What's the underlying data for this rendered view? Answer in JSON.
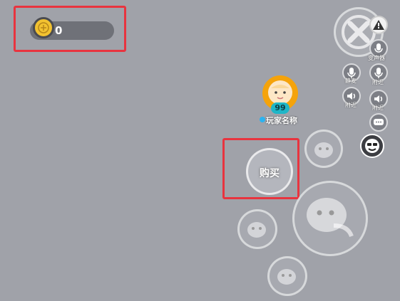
{
  "hud": {
    "coin_count": "0"
  },
  "player": {
    "level": "99",
    "name": "玩家名称"
  },
  "buy_button": {
    "label": "购买"
  },
  "voice": {
    "voice_changer_label": "变声器",
    "mic_mute_label": "静麦",
    "mic_nearby_label": "附近",
    "speaker_nearby_label": "附近",
    "speaker_nearby2_label": "附近"
  },
  "colors": {
    "background": "#a0a2a9",
    "highlight_box": "#e8343f",
    "coin": "#f2c230",
    "level_badge": "#1fb6c7"
  },
  "icons": [
    "coin-icon",
    "close-icon",
    "warning-icon",
    "voice-changer-icon",
    "mic-icon",
    "speaker-icon",
    "chat-icon",
    "emote-icon",
    "penguin-skill-icon"
  ]
}
